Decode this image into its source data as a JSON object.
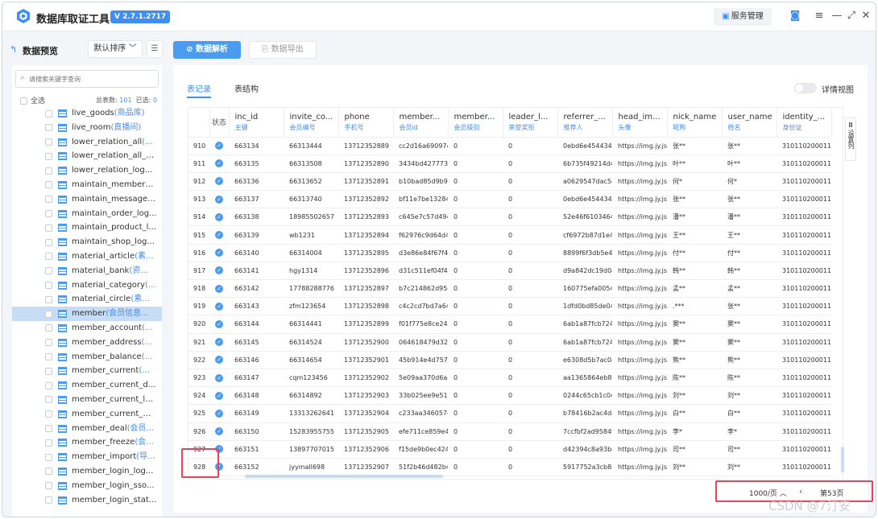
{
  "app": {
    "title": "数据库取证工具",
    "version": "V 2.7.1.2717",
    "service_btn": "服务管理"
  },
  "left": {
    "title": "数据预览",
    "sort_label": "默认排序",
    "search_placeholder": "请搜索关键字查询",
    "select_all": "全选",
    "total_label": "总表数:",
    "total_value": "101",
    "selected_label": "已选:",
    "selected_value": "0",
    "tables": [
      {
        "name": "live_goods",
        "comment": "(商品库)"
      },
      {
        "name": "live_room",
        "comment": "(直播间)"
      },
      {
        "name": "lower_relation_all",
        "comment": "(..."
      },
      {
        "name": "lower_relation_all_s...",
        "comment": ""
      },
      {
        "name": "lower_relation_log...",
        "comment": ""
      },
      {
        "name": "maintain_member_l...",
        "comment": ""
      },
      {
        "name": "maintain_message_...",
        "comment": ""
      },
      {
        "name": "maintain_order_log...",
        "comment": ""
      },
      {
        "name": "maintain_product_l...",
        "comment": ""
      },
      {
        "name": "maintain_shop_log...",
        "comment": ""
      },
      {
        "name": "material_article",
        "comment": "(素..."
      },
      {
        "name": "material_bank",
        "comment": "(资..."
      },
      {
        "name": "material_category",
        "comment": "(..."
      },
      {
        "name": "material_circle",
        "comment": "(素..."
      },
      {
        "name": "member",
        "comment": "(会员信息..."
      },
      {
        "name": "member_account",
        "comment": "(..."
      },
      {
        "name": "member_address",
        "comment": "(..."
      },
      {
        "name": "member_balance",
        "comment": "(..."
      },
      {
        "name": "member_current",
        "comment": "(..."
      },
      {
        "name": "member_current_da...",
        "comment": ""
      },
      {
        "name": "member_current_lo...",
        "comment": ""
      },
      {
        "name": "member_current_m...",
        "comment": ""
      },
      {
        "name": "member_deal",
        "comment": "(会员..."
      },
      {
        "name": "member_freeze",
        "comment": "(会..."
      },
      {
        "name": "member_import",
        "comment": "(导..."
      },
      {
        "name": "member_login_log...",
        "comment": ""
      },
      {
        "name": "member_login_sso...",
        "comment": ""
      },
      {
        "name": "member_login_stat...",
        "comment": ""
      }
    ],
    "selected_index": 14
  },
  "main": {
    "parse_btn": "数据解析",
    "export_btn": "数据导出",
    "tab_records": "表记录",
    "tab_structure": "表结构",
    "detail_view": "详情视图",
    "status_header": "状态",
    "column_settings": "设置列",
    "columns": [
      {
        "name": "inc_id",
        "comment": "主键"
      },
      {
        "name": "invite_co...",
        "comment": "会员编号"
      },
      {
        "name": "phone",
        "comment": "手机号"
      },
      {
        "name": "member...",
        "comment": "会员id"
      },
      {
        "name": "member...",
        "comment": "会员级别"
      },
      {
        "name": "leader_l...",
        "comment": "荣誉奖衔"
      },
      {
        "name": "referrer_...",
        "comment": "推荐人"
      },
      {
        "name": "head_im...",
        "comment": "头像"
      },
      {
        "name": "nick_name",
        "comment": "昵称"
      },
      {
        "name": "user_name",
        "comment": "姓名"
      },
      {
        "name": "identity_...",
        "comment": "身份证"
      }
    ],
    "rows": [
      [
        "910",
        "663134",
        "66313444",
        "13712352889",
        "cc2d16a6909745",
        "0",
        "0",
        "0ebd6e45443440",
        "https://img.jy.jsh",
        "张**",
        "张**",
        "3101102000111"
      ],
      [
        "911",
        "663135",
        "66313508",
        "13712352890",
        "3434bd4277734",
        "0",
        "0",
        "6b735f49214d42",
        "https://img.jy.jsh",
        "叶**",
        "叶**",
        "3101102000111"
      ],
      [
        "912",
        "663136",
        "66313652",
        "13712352891",
        "b10bad85d9b94",
        "0",
        "0",
        "a0629547dac547",
        "https://img.jy.jsh",
        "何*",
        "何*",
        "3101102000111"
      ],
      [
        "913",
        "663137",
        "66313740",
        "13712352892",
        "bf11e7be13284C",
        "0",
        "0",
        "0ebd6e45443440",
        "https://img.jy.jsh",
        "张**",
        "张**",
        "3101102000111"
      ],
      [
        "914",
        "663138",
        "18985502657",
        "13712352893",
        "c645e7c57d4944",
        "0",
        "0",
        "52e46f6103464c",
        "https://img.jy.jsh",
        "潘**",
        "潘**",
        "3101102000111"
      ],
      [
        "915",
        "663139",
        "wb1231",
        "13712352894",
        "f62976c9d64d4b",
        "0",
        "0",
        "cf6972b87d1e4a",
        "https://img.jy.jsh",
        "王**",
        "王**",
        "3101102000111"
      ],
      [
        "916",
        "663140",
        "66314004",
        "13712352895",
        "d3e86e84f67f48",
        "0",
        "0",
        "8899f6f3db5e44",
        "https://img.jy.jsh",
        "付**",
        "付**",
        "3101102000111"
      ],
      [
        "917",
        "663141",
        "hgy1314",
        "13712352896",
        "d31c511ef04f48",
        "0",
        "0",
        "d9a842dc19d049",
        "https://img.jy.jsh",
        "韩**",
        "韩**",
        "3101102000111"
      ],
      [
        "918",
        "663142",
        "17788288776",
        "13712352897",
        "b7c214862d954",
        "0",
        "0",
        "160775efa00541",
        "https://img.jy.jsh",
        "孟**",
        "孟**",
        "3101102000111"
      ],
      [
        "919",
        "663143",
        "zfm123654",
        "13712352898",
        "c4c2cd7bd7a64",
        "0",
        "0",
        "1dfd0bd85de042",
        "https://img.jy.jsh",
        ".***",
        "张**",
        "3101102000111"
      ],
      [
        "920",
        "663144",
        "66314441",
        "13712352899",
        "f01f775e8ce247",
        "0",
        "0",
        "6ab1a87fcb7244",
        "https://img.jy.jsh",
        "窦**",
        "窦**",
        "3101102000111"
      ],
      [
        "921",
        "663145",
        "66314524",
        "13712352900",
        "064618479d324",
        "0",
        "0",
        "6ab1a87fcb7244",
        "https://img.jy.jsh",
        "窦**",
        "窦**",
        "3101102000111"
      ],
      [
        "922",
        "663146",
        "66314654",
        "13712352901",
        "45b914e4d7574",
        "0",
        "0",
        "e6308d5b7ac046",
        "https://img.jy.jsh",
        "熊**",
        "熊**",
        "3101102000111"
      ],
      [
        "923",
        "663147",
        "cqm123456",
        "13712352902",
        "5e09aa370d6a4",
        "0",
        "0",
        "aa1365864eb842",
        "https://img.jy.jsh",
        "陈**",
        "陈**",
        "3101102000111"
      ],
      [
        "924",
        "663148",
        "66314892",
        "13712352903",
        "33b025ee9e514",
        "0",
        "0",
        "0244c65cb1c042",
        "https://img.jy.jsh",
        "刘**",
        "刘**",
        "3101102000111"
      ],
      [
        "925",
        "663149",
        "13313262641",
        "13712352904",
        "c233aa3460574c",
        "0",
        "0",
        "b78416b2ac4d4",
        "https://img.jy.jsh",
        "白**",
        "白**",
        "3101102000111"
      ],
      [
        "926",
        "663150",
        "15283955755",
        "13712352905",
        "efe711ce859e41",
        "0",
        "0",
        "7ccfbf2ad95849",
        "https://img.jy.jsh",
        "李*",
        "李*",
        "3101102000111"
      ],
      [
        "927",
        "663151",
        "13897707015",
        "13712352906",
        "f15de9b0ec4240",
        "0",
        "0",
        "d42394c8a93b4",
        "https://img.jy.jsh",
        "司**",
        "司**",
        "3101102000111"
      ],
      [
        "928",
        "663152",
        "jyymall698",
        "13712352907",
        "51f2b46d482b4",
        "0",
        "0",
        "5917752a3cb846",
        "https://img.jy.jsh",
        "刘**",
        "刘**",
        "3101102000111"
      ]
    ],
    "page_size": "1000/页",
    "page_label": "第53页"
  },
  "watermark": "CSDN @7汀安"
}
